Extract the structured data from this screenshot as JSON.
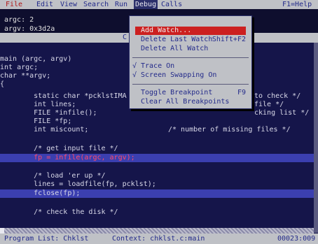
{
  "menubar": {
    "items": [
      "File",
      "Edit",
      "View",
      "Search",
      "Run",
      "Debug",
      "Calls"
    ],
    "help": "F1=Help"
  },
  "watch": {
    "lines": [
      "argc: 2",
      "argv: 0x3d2a"
    ]
  },
  "window_title_partial": "C",
  "code": {
    "lines": [
      "",
      "main (argc, argv)",
      "int argc;",
      "char **argv;",
      "{",
      "        static char *pcklstIMA",
      "        int lines;",
      "        FILE *infile();",
      "        FILE *fp;",
      "        int miscount;",
      "",
      "        /* get input file */",
      "        fp = infile(argc, argv);",
      "",
      "        /* load 'er up */",
      "        lines = loadfile(fp, pcklst);",
      "        fclose(fp);",
      "",
      "        /* check the disk */"
    ],
    "right_text": {
      "l5": "to check */",
      "l6": "file */",
      "l7": "cking list */",
      "l9": "/* number of missing files */"
    },
    "highlight_lines": [
      12,
      16
    ]
  },
  "debug_menu": {
    "items": [
      {
        "label": "Add Watch...",
        "shortcut": "",
        "selected": true,
        "check": ""
      },
      {
        "label": "Delete Last Watch",
        "shortcut": "Shift+F2",
        "selected": false,
        "check": ""
      },
      {
        "label": "Delete All Watch",
        "shortcut": "",
        "selected": false,
        "check": ""
      },
      {
        "label": "Trace On",
        "shortcut": "",
        "selected": false,
        "check": "√"
      },
      {
        "label": "Screen Swapping On",
        "shortcut": "",
        "selected": false,
        "check": "√"
      },
      {
        "label": "Toggle Breakpoint",
        "shortcut": "F9",
        "selected": false,
        "check": ""
      },
      {
        "label": "Clear All Breakpoints",
        "shortcut": "",
        "selected": false,
        "check": ""
      }
    ]
  },
  "status": {
    "program_list": "Program List: Chklst",
    "context": "Context: chklst.c:main",
    "position": "00023:009"
  },
  "colors": {
    "background": "#15154a",
    "menubar": "#bfc1c6",
    "highlight": "#3b3fb0",
    "selected_item": "#cc2020"
  }
}
